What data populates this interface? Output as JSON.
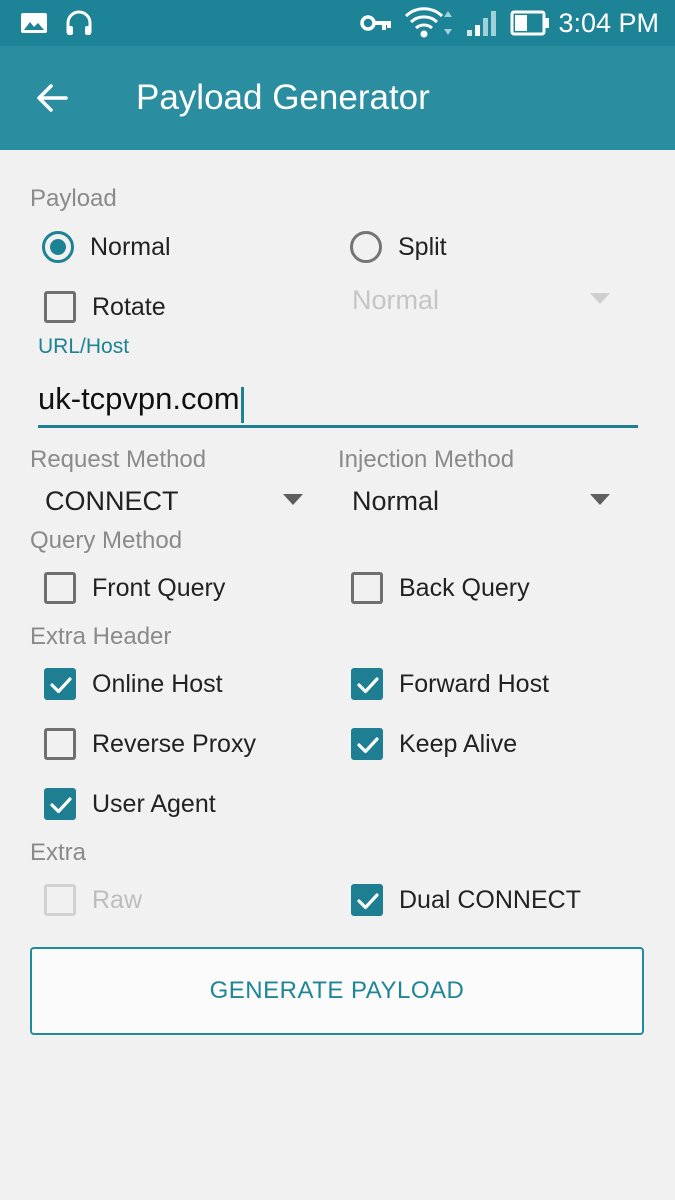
{
  "status_bar": {
    "time": "3:04 PM",
    "icons": [
      "image-icon",
      "headset-icon",
      "vpn-key-icon",
      "wifi-icon",
      "signal-icon",
      "battery-icon"
    ]
  },
  "app_bar": {
    "title": "Payload Generator",
    "back_icon": "arrow-back-icon"
  },
  "payload": {
    "label": "Payload",
    "options": [
      {
        "label": "Normal",
        "selected": true
      },
      {
        "label": "Split",
        "selected": false
      }
    ],
    "rotate": {
      "label": "Rotate",
      "checked": false
    },
    "split_type": {
      "value": "Normal",
      "enabled": false
    }
  },
  "url_host": {
    "label": "URL/Host",
    "value": "uk-tcpvpn.com"
  },
  "request_method": {
    "label": "Request Method",
    "value": "CONNECT"
  },
  "injection_method": {
    "label": "Injection Method",
    "value": "Normal"
  },
  "query_method": {
    "label": "Query Method",
    "options": [
      {
        "label": "Front Query",
        "checked": false
      },
      {
        "label": "Back Query",
        "checked": false
      }
    ]
  },
  "extra_header": {
    "label": "Extra Header",
    "options": [
      {
        "label": "Online Host",
        "checked": true
      },
      {
        "label": "Forward Host",
        "checked": true
      },
      {
        "label": "Reverse Proxy",
        "checked": false
      },
      {
        "label": "Keep Alive",
        "checked": true
      },
      {
        "label": "User Agent",
        "checked": true
      }
    ]
  },
  "extra": {
    "label": "Extra",
    "options": [
      {
        "label": "Raw",
        "checked": false,
        "enabled": false
      },
      {
        "label": "Dual CONNECT",
        "checked": true,
        "enabled": true
      }
    ]
  },
  "generate_button": {
    "label": "GENERATE PAYLOAD"
  },
  "colors": {
    "accent": "#1d8293",
    "app_bar": "#2a8ea0",
    "status_bar": "#1c8496",
    "background": "#f1f1f1"
  }
}
